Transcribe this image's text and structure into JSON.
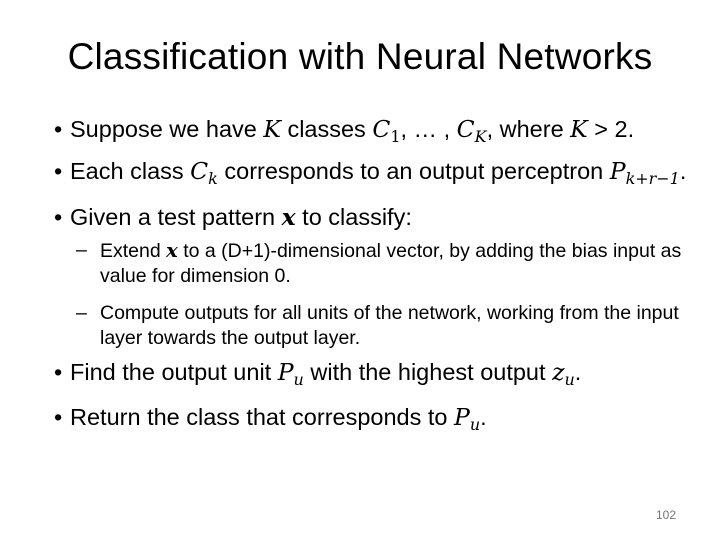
{
  "title": "Classification with Neural Networks",
  "bullets": {
    "b1": {
      "a": "Suppose we have ",
      "K": "K",
      "b": " classes ",
      "C1": "C",
      "C1s": "1",
      "c": ", … , ",
      "CK": "C",
      "CKs": "K",
      "d": ", where ",
      "K2": "K",
      "e": " > 2."
    },
    "b2": {
      "a": "Each class ",
      "Ck": "C",
      "Cks": "k",
      "b": " corresponds to an output perceptron ",
      "P": "P",
      "Ps": "k+r−1",
      "c": "."
    },
    "b3": {
      "a": "Given a test pattern ",
      "x": "x",
      "b": " to classify:"
    },
    "s1": {
      "a": "Extend ",
      "x": "x",
      "b": " to a (D+1)-dimensional vector, by adding the bias input as value for dimension 0."
    },
    "s2": {
      "a": "Compute outputs for all units of the network, working from the input layer towards the output layer."
    },
    "b4": {
      "a": "Find the output unit ",
      "P": "P",
      "Ps": "u",
      "b": " with the highest output ",
      "z": "z",
      "zs": "u",
      "c": "."
    },
    "b5": {
      "a": "Return the class that corresponds to ",
      "P": "P",
      "Ps": "u",
      "c": "."
    }
  },
  "page_number": "102"
}
